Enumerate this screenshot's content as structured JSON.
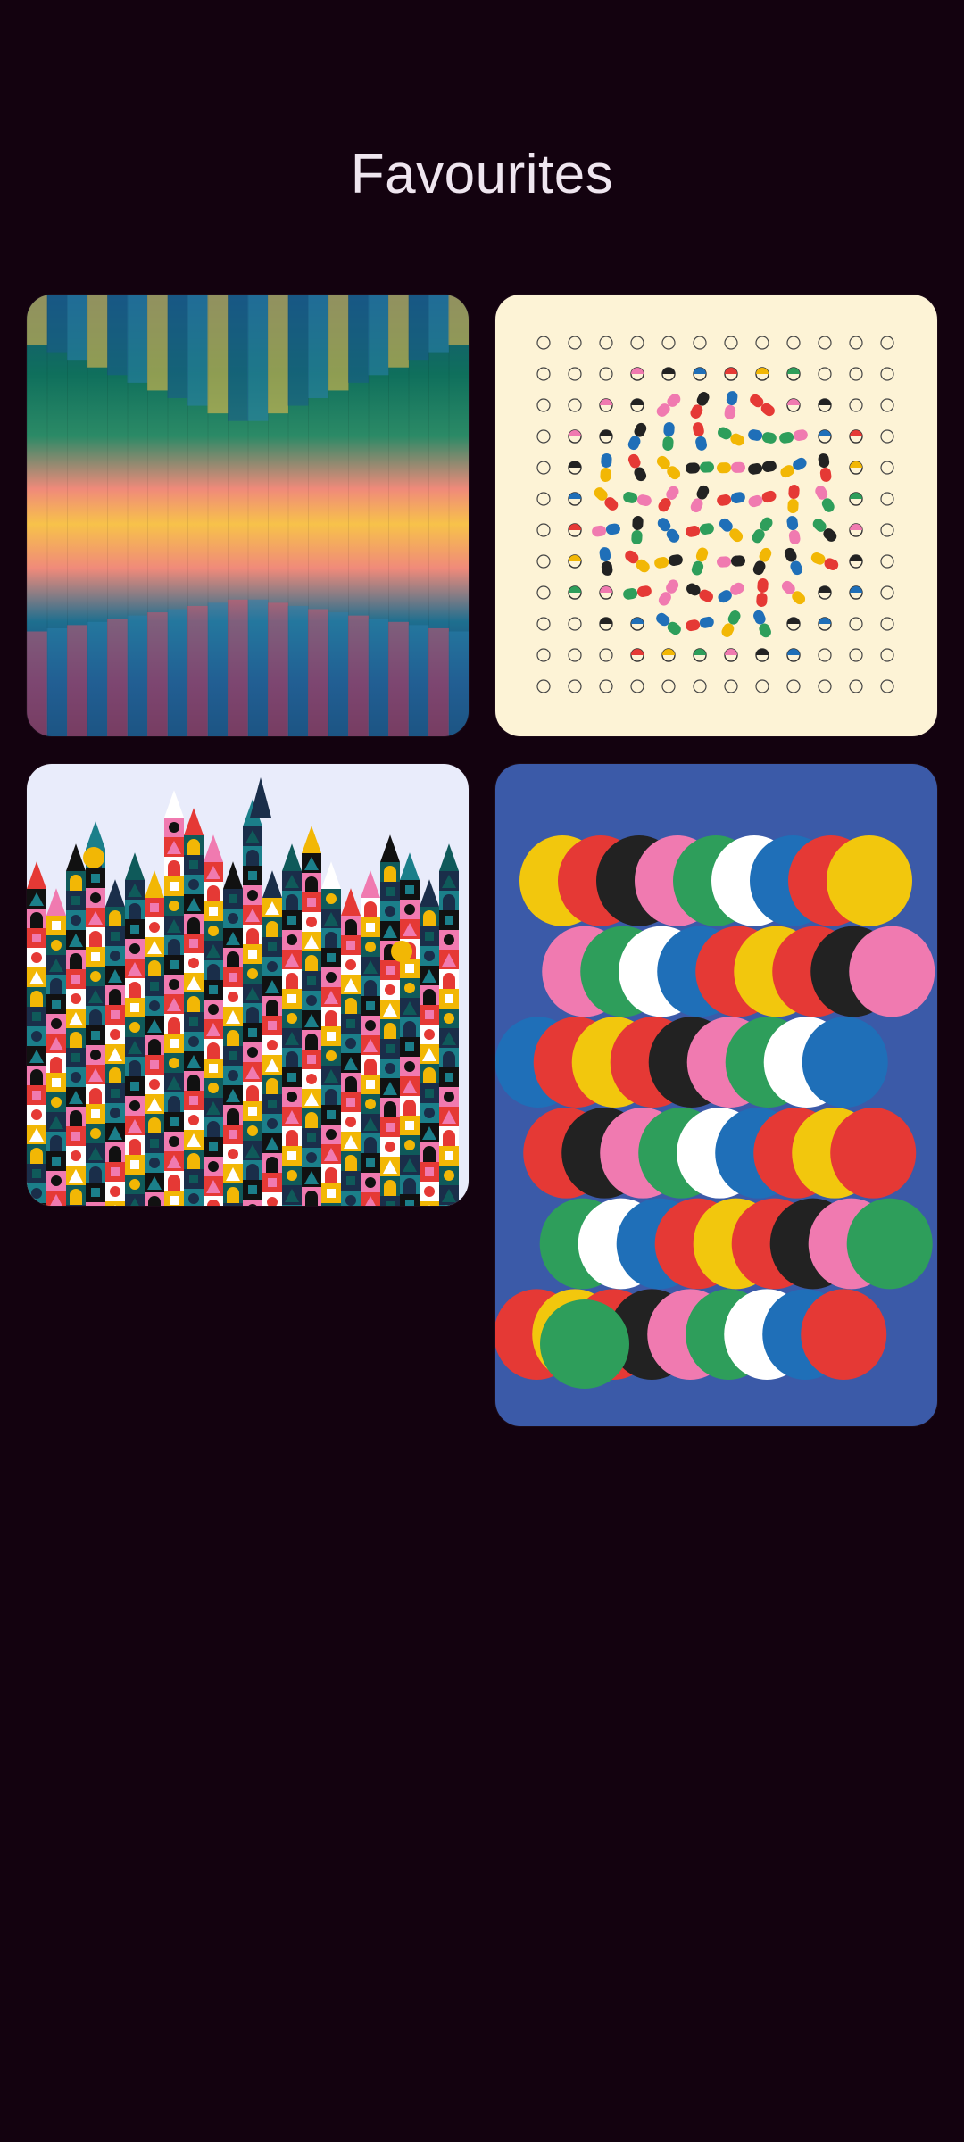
{
  "header": {
    "title": "Favourites"
  },
  "favourites": [
    {
      "name": "wave-gradient-artwork",
      "background": "#f7c24a"
    },
    {
      "name": "capsule-dots-artwork",
      "background": "#fdf3d6"
    },
    {
      "name": "geometric-city-artwork",
      "background": "#e9ecfb"
    },
    {
      "name": "curvy-stripes-artwork",
      "background": "#3b5aa8"
    }
  ]
}
